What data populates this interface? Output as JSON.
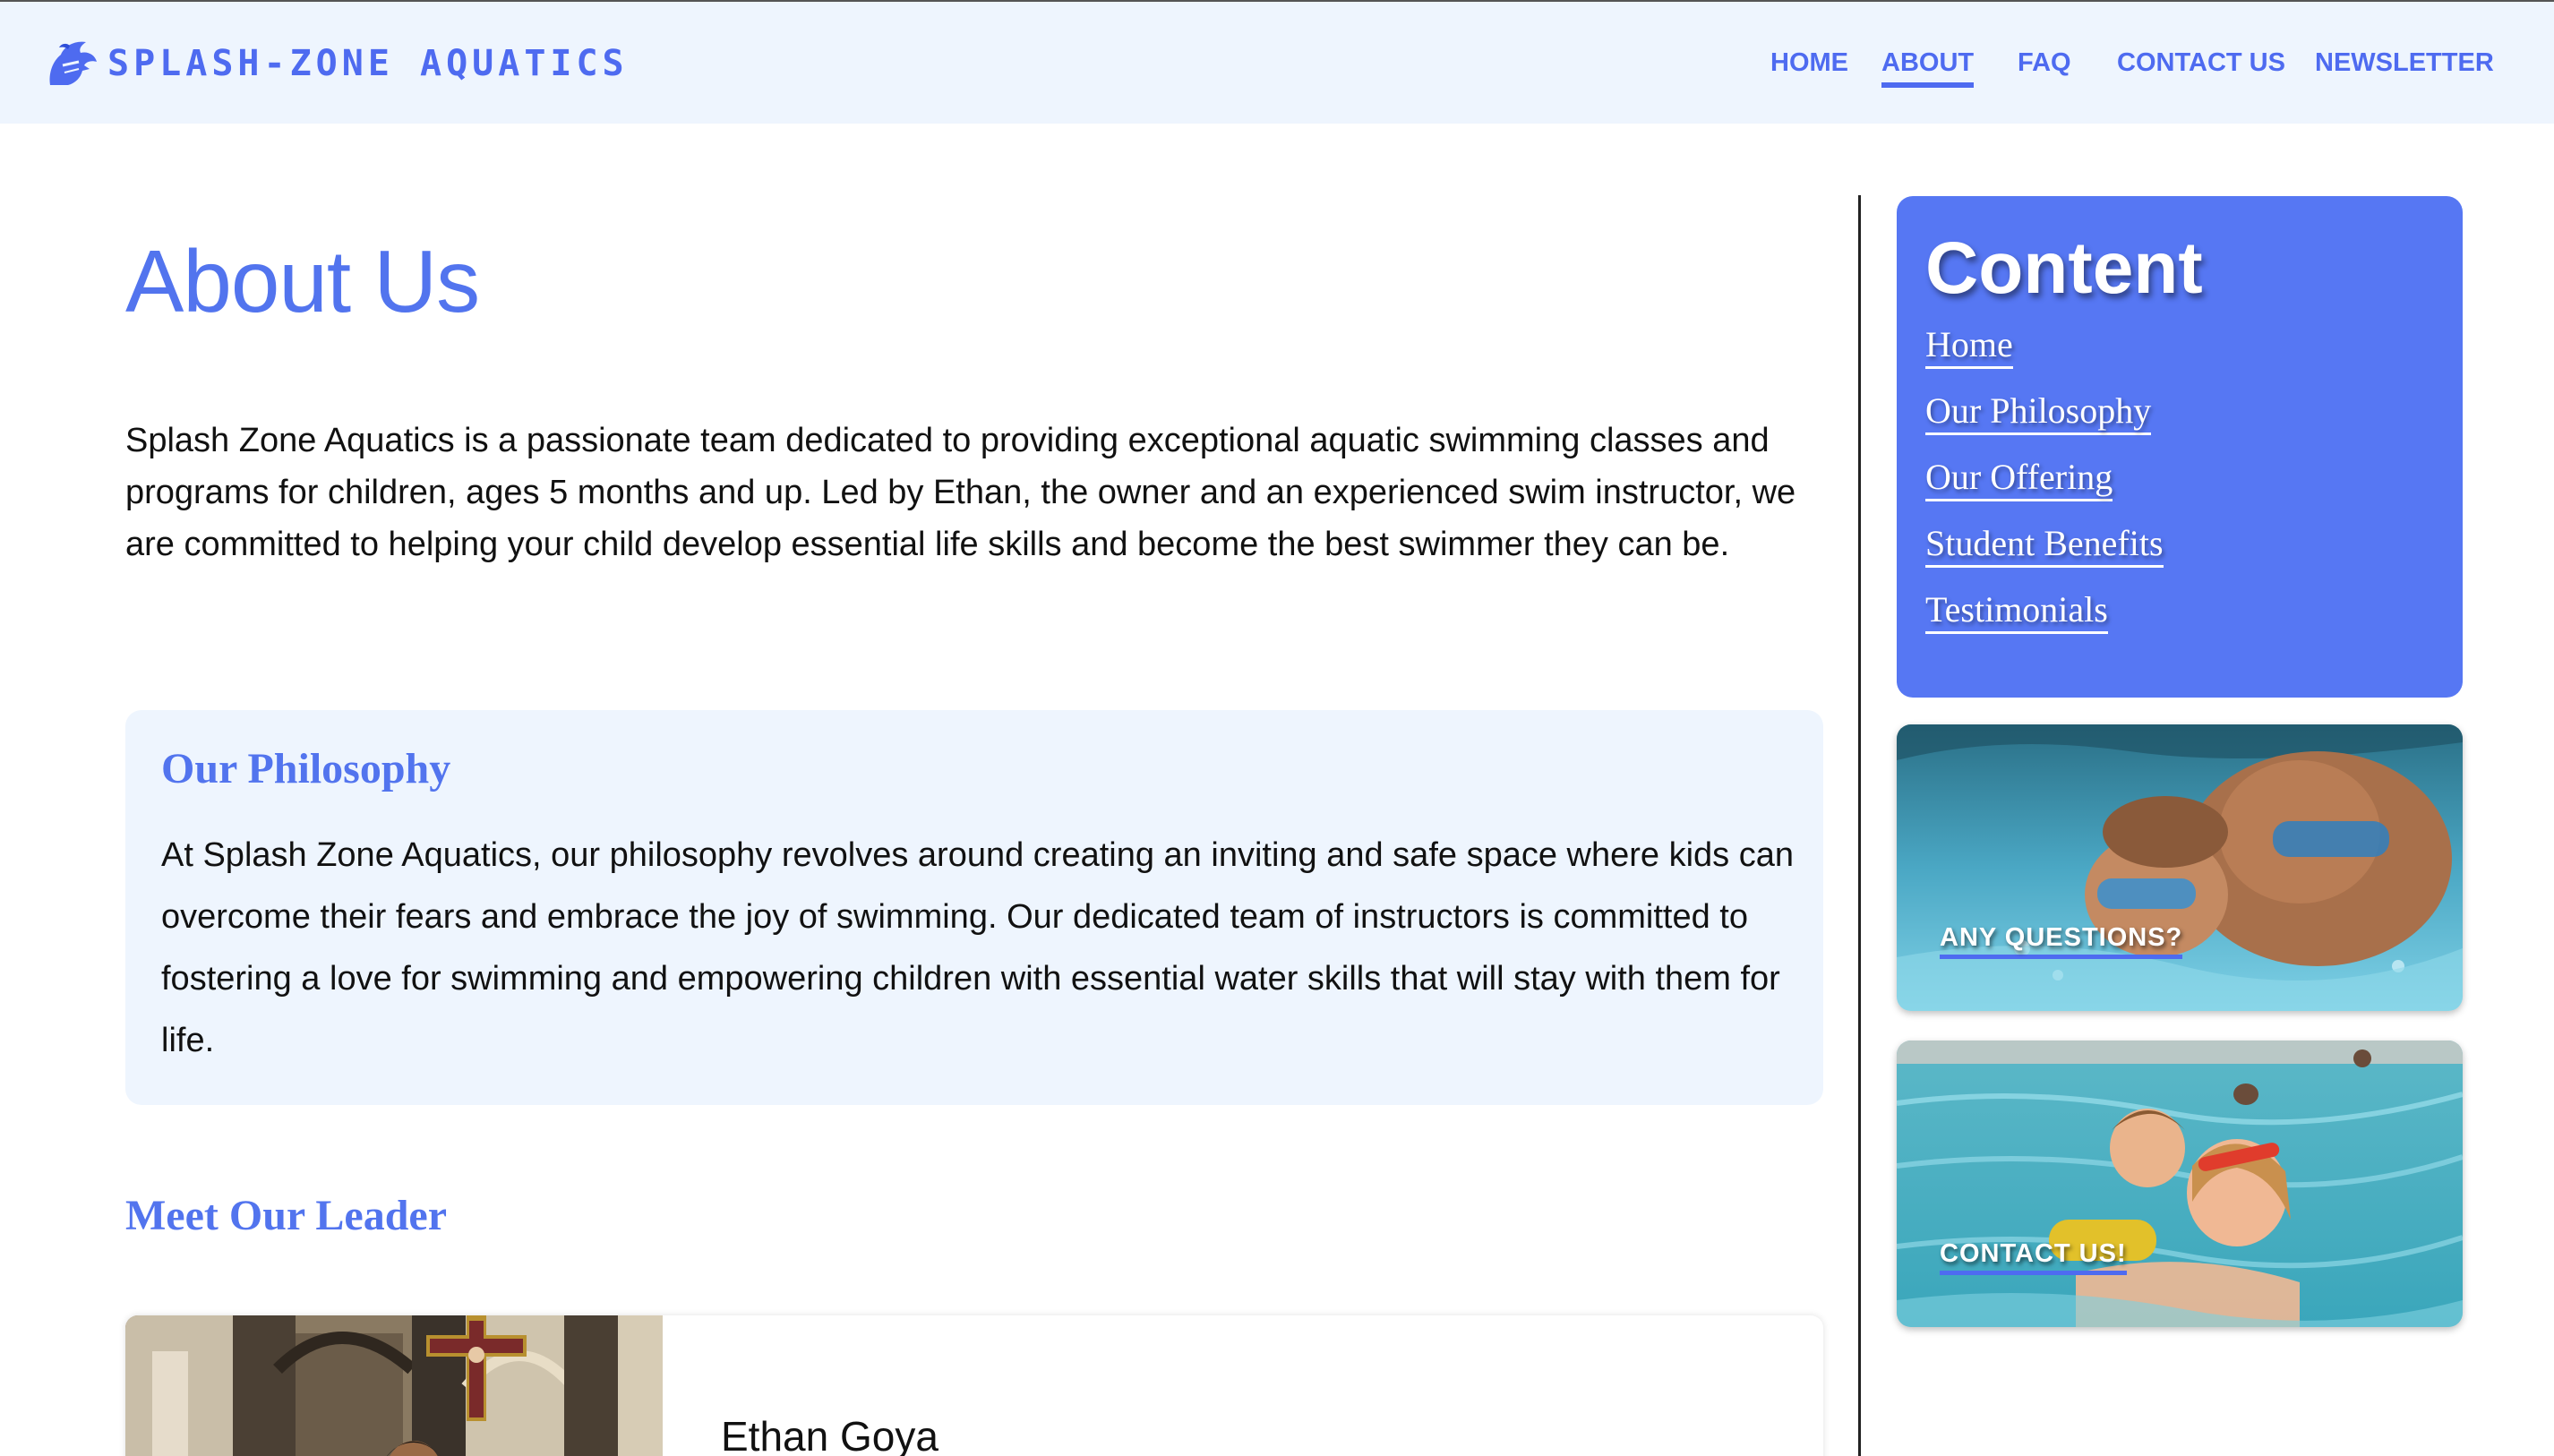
{
  "colors": {
    "accent": "#4e6bf0",
    "title_blue": "#5274ee",
    "header_background": "#eef5fe",
    "sidebar_panel": "#5677f3"
  },
  "header": {
    "brand_icon": "knight-helmet-icon",
    "brand_name": "SPLASH-ZONE AQUATICS",
    "nav": [
      {
        "label": "HOME",
        "active": false
      },
      {
        "label": "ABOUT",
        "active": true
      },
      {
        "label": "FAQ",
        "active": false
      },
      {
        "label": "CONTACT US",
        "active": false
      },
      {
        "label": "NEWSLETTER",
        "active": false
      }
    ]
  },
  "main": {
    "title": "About Us",
    "intro": "Splash Zone Aquatics is a passionate team dedicated to providing exceptional aquatic swimming classes and programs for children, ages 5 months and up. Led by Ethan, the owner and an experienced swim instructor, we are committed to helping your child develop essential life skills and become the best swimmer they can be.",
    "philosophy": {
      "heading": "Our Philosophy",
      "body": "At Splash Zone Aquatics, our philosophy revolves around creating an inviting and safe space where kids can overcome their fears and embrace the joy of swimming. Our dedicated team of instructors is committed to fostering a love for swimming and empowering children with essential water skills that will stay with them for life."
    },
    "leader": {
      "heading": "Meet Our Leader",
      "name": "Ethan Goya"
    }
  },
  "sidebar": {
    "title": "Content",
    "links": [
      "Home",
      "Our Philosophy",
      "Our Offering",
      "Student Benefits",
      "Testimonials"
    ],
    "promos": [
      {
        "label": "ANY QUESTIONS?"
      },
      {
        "label": "CONTACT US!"
      }
    ]
  }
}
